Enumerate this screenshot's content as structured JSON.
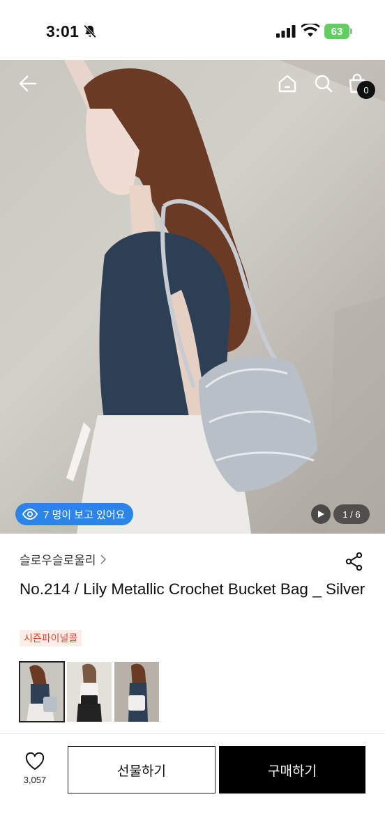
{
  "status_bar": {
    "time": "3:01",
    "battery": "63"
  },
  "header": {
    "cart_count": "0"
  },
  "hero": {
    "viewers_text": "7 명이 보고 있어요",
    "page_indicator": "1 / 6"
  },
  "product": {
    "brand": "슬로우슬로울리",
    "title": "No.214 / Lily Metallic Crochet Bucket Bag _ Silver",
    "tag": "시즌파이널콜"
  },
  "bottom_bar": {
    "like_count": "3,057",
    "gift_label": "선물하기",
    "buy_label": "구매하기"
  },
  "icons": [
    "bell-slash-icon",
    "signal-icon",
    "wifi-icon",
    "back-arrow-icon",
    "home-icon",
    "search-icon",
    "shopping-bag-icon",
    "eye-icon",
    "play-icon",
    "chevron-right-icon",
    "share-icon",
    "heart-icon"
  ],
  "colors": {
    "viewers_pill": "#2b84e8",
    "tag_text": "#e04a2a",
    "tag_bg": "#fdeeea",
    "buy_button": "#000000",
    "battery": "#5fcf62"
  }
}
